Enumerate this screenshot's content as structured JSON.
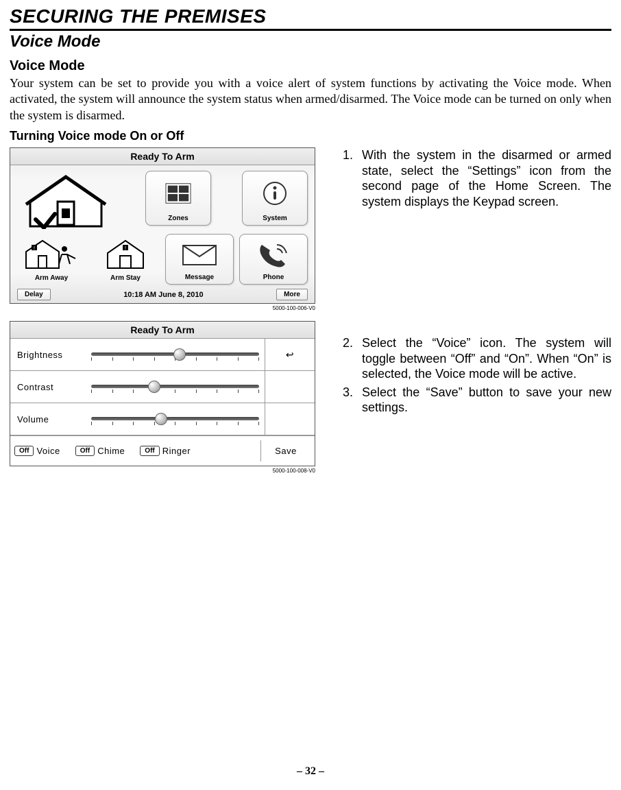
{
  "title": "SECURING THE PREMISES",
  "subtitle": "Voice Mode",
  "h3": "Voice Mode",
  "intro": "Your system can be set to provide you with a voice alert of system functions by activating the Voice mode. When activated, the system will announce the system status when armed/disarmed. The Voice mode can be turned on only when the system is disarmed.",
  "h4": "Turning Voice mode On or Off",
  "panel1": {
    "bar": "Ready To Arm",
    "tiles": {
      "zones": "Zones",
      "system": "System",
      "arm_away": "Arm Away",
      "arm_stay": "Arm Stay",
      "message": "Message",
      "phone": "Phone"
    },
    "delay": "Delay",
    "status": "10:18 AM  June 8,  2010",
    "more": "More",
    "caption": "5000-100-006-V0"
  },
  "panel2": {
    "bar": "Ready To Arm",
    "brightness": "Brightness",
    "contrast": "Contrast",
    "volume": "Volume",
    "back": "↩",
    "voice_state": "Off",
    "voice": "Voice",
    "chime_state": "Off",
    "chime": "Chime",
    "ringer_state": "Off",
    "ringer": "Ringer",
    "save": "Save",
    "caption": "5000-100-008-V0"
  },
  "steps": [
    {
      "num": "1.",
      "text": "With the system in the disarmed or armed state, select the “Settings” icon from the second page of the Home Screen. The system displays the Keypad screen."
    },
    {
      "num": "2.",
      "text": "Select the “Voice” icon. The system will toggle between “Off” and “On”. When “On” is selected, the Voice mode will be active."
    },
    {
      "num": "3.",
      "text": "Select the “Save” button to save your new settings."
    }
  ],
  "page_number": "– 32 –"
}
